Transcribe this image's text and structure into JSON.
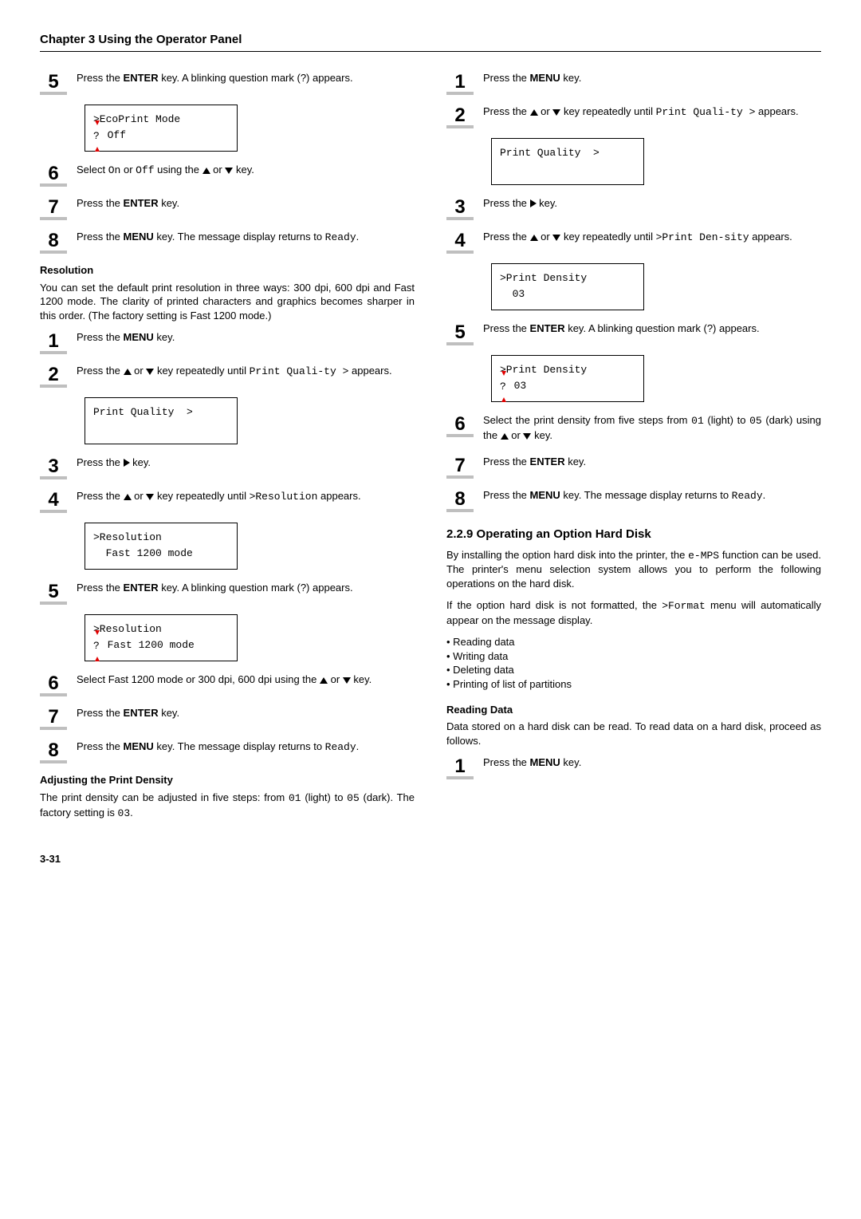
{
  "chapter_title": "Chapter 3  Using the Operator Panel",
  "page_number": "3-31",
  "left": {
    "step5": {
      "pre": "Press the ",
      "key": "ENTER",
      "post": " key. A blinking question mark (?) appears."
    },
    "lcd1_line1": ">EcoPrint Mode",
    "lcd1_line2_after": " Off",
    "step6": {
      "pre": "Select ",
      "on": "On",
      "mid": " or ",
      "off": "Off",
      "post": " using the ",
      "end": " key."
    },
    "step7": {
      "pre": "Press the ",
      "key": "ENTER",
      "post": " key."
    },
    "step8": {
      "pre": "Press the ",
      "key": "MENU",
      "mid": " key. The message display returns to ",
      "ready": "Ready",
      "post": "."
    },
    "resolution_head": "Resolution",
    "resolution_para": "You can set the default print resolution in three ways: 300 dpi, 600 dpi and Fast 1200 mode. The clarity of printed characters and graphics becomes sharper in this order. (The factory setting is Fast 1200 mode.)",
    "r_step1": {
      "pre": "Press the ",
      "key": "MENU",
      "post": " key."
    },
    "r_step2": {
      "pre": "Press the ",
      "mid": " key repeatedly until ",
      "code": "Print Quali-ty >",
      "post": " appears."
    },
    "r_lcd2_line1": "Print Quality  >",
    "r_step3": {
      "pre": "Press the ",
      "post": " key."
    },
    "r_step4": {
      "pre": "Press the ",
      "mid": " key repeatedly until ",
      "code": ">Resolution",
      "post": " appears."
    },
    "r_lcd3_line1": ">Resolution",
    "r_lcd3_line2": "  Fast 1200 mode",
    "r_step5": {
      "pre": "Press the ",
      "key": "ENTER",
      "post": " key. A blinking question mark (?) appears."
    },
    "r_lcd4_line1": ">Resolution",
    "r_lcd4_line2_after": " Fast 1200 mode",
    "r_step6": {
      "pre": "Select Fast 1200 mode or 300 dpi, 600 dpi using the ",
      "post": " key."
    },
    "r_step7": {
      "pre": "Press the ",
      "key": "ENTER",
      "post": " key."
    },
    "r_step8": {
      "pre": "Press the ",
      "key": "MENU",
      "mid": " key. The message display returns to ",
      "ready": "Ready",
      "post": "."
    },
    "density_head": "Adjusting the Print Density",
    "density_para_pre": "The print density can be adjusted in five steps: from ",
    "density_01": "01",
    "density_mid1": " (light) to ",
    "density_05": "05",
    "density_mid2": " (dark). The factory setting is ",
    "density_03": "03",
    "density_end": "."
  },
  "right": {
    "d_step1": {
      "pre": "Press the ",
      "key": "MENU",
      "post": " key."
    },
    "d_step2": {
      "pre": "Press the ",
      "mid": " key repeatedly until ",
      "code": "Print Quali-ty >",
      "post": " appears."
    },
    "d_lcd1_line1": "Print Quality  >",
    "d_step3": {
      "pre": "Press the ",
      "post": " key."
    },
    "d_step4": {
      "pre": "Press the ",
      "mid": " key repeatedly until ",
      "code": ">Print Den-sity",
      "post": " appears."
    },
    "d_lcd2_line1": ">Print Density",
    "d_lcd2_line2": "  03",
    "d_step5": {
      "pre": "Press the ",
      "key": "ENTER",
      "post": " key. A blinking question mark (?) appears."
    },
    "d_lcd3_line1": ">Print Density",
    "d_lcd3_line2_after": " 03",
    "d_step6": {
      "pre": "Select the print density from five steps from ",
      "c01": "01",
      "mid1": " (light) to ",
      "c05": "05",
      "mid2": " (dark) using the ",
      "post": " key."
    },
    "d_step7": {
      "pre": "Press the ",
      "key": "ENTER",
      "post": " key."
    },
    "d_step8": {
      "pre": "Press the ",
      "key": "MENU",
      "mid": " key. The message display returns to ",
      "ready": "Ready",
      "post": "."
    },
    "hd_title": "2.2.9 Operating an Option Hard Disk",
    "hd_para1_pre": "By installing the option hard disk into the printer, the ",
    "hd_para1_code": "e-MPS",
    "hd_para1_post": " function can be used. The printer's menu selection system allows you to perform the following operations on the hard disk.",
    "hd_para2_pre": "If the option hard disk is not formatted, the ",
    "hd_para2_code": ">Format",
    "hd_para2_post": " menu will automatically appear on the message display.",
    "bullets": [
      "Reading data",
      "Writing data",
      "Deleting data",
      "Printing of list of partitions"
    ],
    "reading_head": "Reading Data",
    "reading_para": "Data stored on a hard disk can be read. To read data on a hard disk, proceed as follows.",
    "rd_step1": {
      "pre": "Press the ",
      "key": "MENU",
      "post": " key."
    }
  },
  "or_word": " or ",
  "q_mark": "?"
}
